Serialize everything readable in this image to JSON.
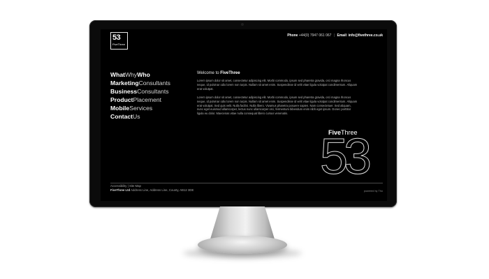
{
  "header": {
    "logo_number": "53",
    "logo_name": "FiveThree",
    "phone_label": "Phone",
    "phone_value": "+44(0) 7947 061 067",
    "email_label": "Email",
    "email_value": "info@fivethree.co.uk"
  },
  "nav": {
    "items": [
      {
        "bold": "What",
        "rest": "",
        "tail_bold": "Who",
        "mid": "Why"
      },
      {
        "bold": "Marketing",
        "rest": "Consultants"
      },
      {
        "bold": "Business",
        "rest": "Consultants"
      },
      {
        "bold": "Product",
        "rest": "Placement"
      },
      {
        "bold": "Mobile",
        "rest": "Services"
      },
      {
        "bold": "Contact",
        "rest": "Us"
      }
    ]
  },
  "intro": {
    "title_prefix": "Welcome to ",
    "title_brand": "FiveThree",
    "paragraph1": "Lorem ipsum dolor sit amet, consectetur adipiscing elit. Morbi commodo, ipsum sed pharetra gravida, orci magna rhoncus neque, id pulvinar odio lorem non turpis. Nullam sit amet enim. Suspendisse id velit vitae ligula volutpat condimentum. Aliquam erat volutpat.",
    "paragraph2": "Lorem ipsum dolor sit amet, consectetur adipiscing elit. Morbi commodo, ipsum sed pharetra gravida, orci magna rhoncus neque, id pulvinar odio lorem non turpis. Nullam sit amet enim. Suspendisse id velit vitae ligula volutpat condimentum. Aliquam erat volutpat. Sed quis velit. Nulla facilisi. Nulla libero. Vivamus pharetra posuere sapien. Nam consectetuer. Sed aliquam, nunc eget euismod ullamcorper, lectus nunc ullamcorper orci, fermentum bibendum enim nibh eget ipsum. Donec porttitor ligula eu dolor. Maecenas vitae nulla consequat libero cursus venenatis."
  },
  "brand": {
    "title_bold": "Five",
    "title_regular": "Three",
    "big_number": "53"
  },
  "footer": {
    "link_accessibility": "Accessibility",
    "link_sep": "|",
    "link_sitemap": "Site Map",
    "company": "FiveThree Ltd",
    "address": "Address Line, Address Line, County, AB12 3DE",
    "powered": "powered by Tho"
  }
}
